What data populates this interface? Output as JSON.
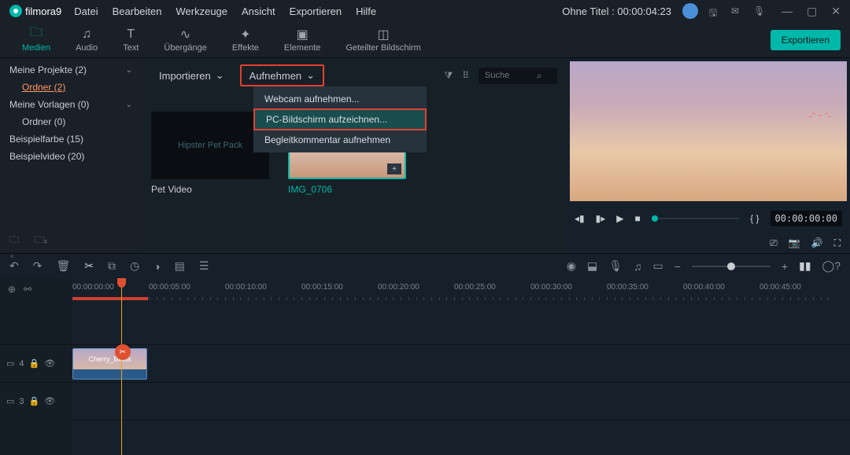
{
  "app": {
    "name": "filmora",
    "version": "9"
  },
  "menu": [
    "Datei",
    "Bearbeiten",
    "Werkzeuge",
    "Ansicht",
    "Exportieren",
    "Hilfe"
  ],
  "project": {
    "title": "Ohne Titel",
    "time": "00:00:04:23"
  },
  "tabs": [
    {
      "id": "media",
      "label": "Medien",
      "icon": "folder"
    },
    {
      "id": "audio",
      "label": "Audio",
      "icon": "music"
    },
    {
      "id": "text",
      "label": "Text",
      "icon": "text"
    },
    {
      "id": "trans",
      "label": "Übergänge",
      "icon": "wave"
    },
    {
      "id": "effects",
      "label": "Effekte",
      "icon": "sparkle"
    },
    {
      "id": "elements",
      "label": "Elemente",
      "icon": "image"
    },
    {
      "id": "split",
      "label": "Geteilter Bildschirm",
      "icon": "split"
    }
  ],
  "export_label": "Exportieren",
  "toolbar": {
    "import_label": "Importieren",
    "record_label": "Aufnehmen",
    "search_placeholder": "Suche"
  },
  "record_menu": [
    "Webcam aufnehmen...",
    "PC-Bildschirm aufzeichnen...",
    "Begleitkommentar aufnehmen"
  ],
  "sidebar": {
    "items": [
      {
        "label": "Meine Projekte (2)",
        "expandable": true
      },
      {
        "label": "Ordner (2)",
        "sub": true,
        "highlight": true
      },
      {
        "label": "Meine Vorlagen (0)",
        "expandable": true
      },
      {
        "label": "Ordner (0)",
        "sub": true
      },
      {
        "label": "Beispielfarbe (15)"
      },
      {
        "label": "Beispielvideo (20)"
      }
    ]
  },
  "thumbs": [
    {
      "label": "Pet Video",
      "overlay": "Hipster Pet Pack",
      "selected": false
    },
    {
      "label": "IMG_0706",
      "overlay": "",
      "selected": true,
      "sky": true
    }
  ],
  "preview": {
    "playtime": "00:00:00:00",
    "markers": "{   }"
  },
  "timeline": {
    "ruler": [
      "00:00:00:00",
      "00:00:05:00",
      "00:00:10:00",
      "00:00:15:00",
      "00:00:20:00",
      "00:00:25:00",
      "00:00:30:00",
      "00:00:35:00",
      "00:00:40:00",
      "00:00:45:00"
    ],
    "tracks": [
      {
        "id": 4,
        "icon": "video",
        "clip_label": "Cherry_Bloss"
      },
      {
        "id": 3,
        "icon": "video"
      }
    ]
  }
}
